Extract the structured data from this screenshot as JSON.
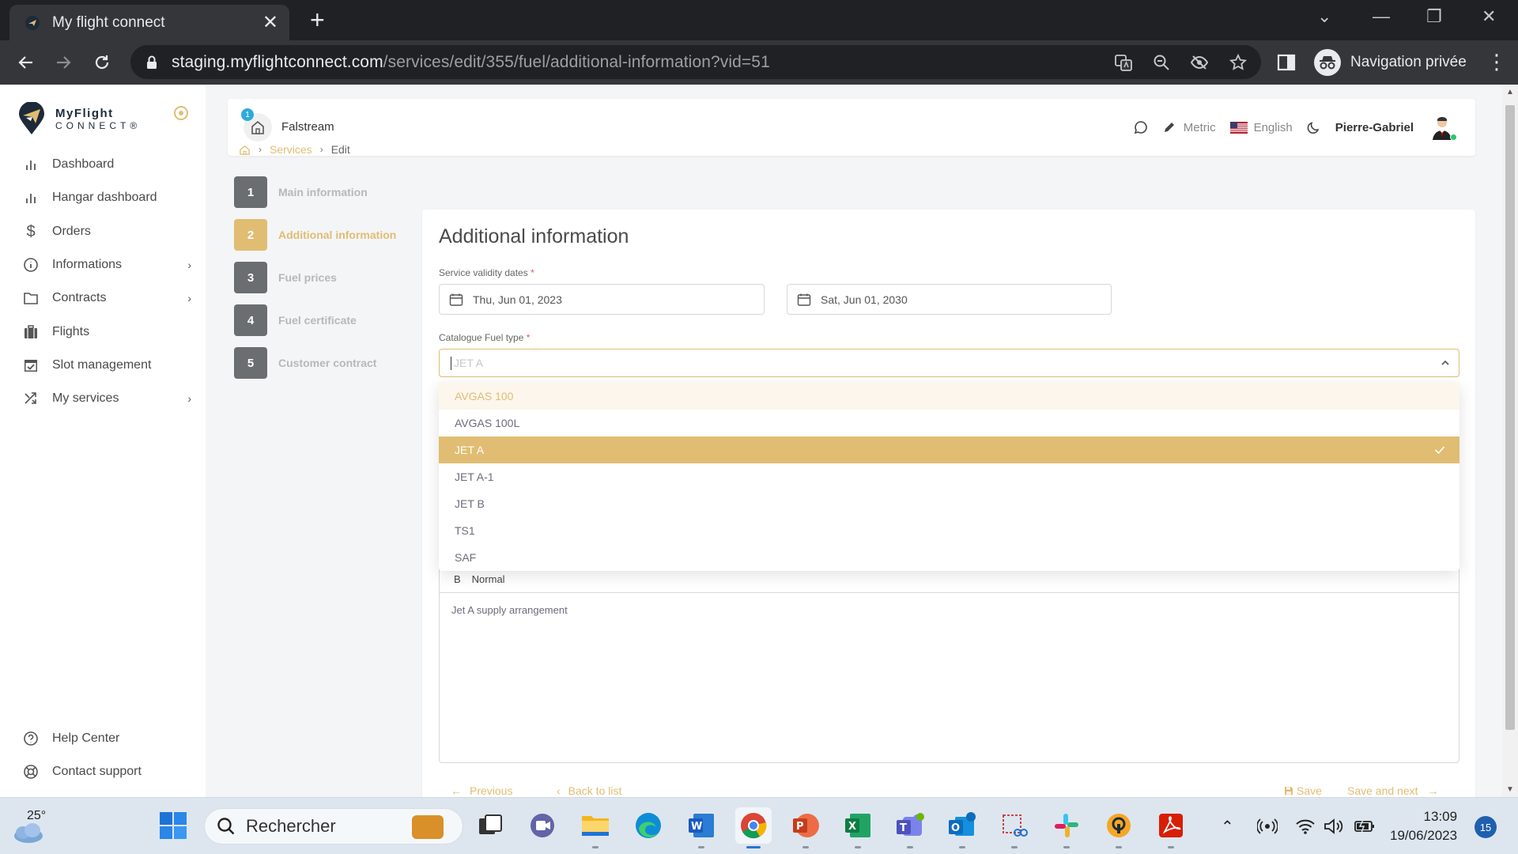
{
  "browser": {
    "tab_title": "My flight connect",
    "url_host": "staging.myflightconnect.com",
    "url_path": "/services/edit/355/fuel/additional-information?vid=51",
    "profile_label": "Navigation privée"
  },
  "sidebar": {
    "logo_line1": "MyFlight",
    "logo_line2": "CONNECT®",
    "items": [
      {
        "label": "Dashboard",
        "icon": "bar-chart-icon",
        "has_children": false
      },
      {
        "label": "Hangar dashboard",
        "icon": "bar-chart-icon",
        "has_children": false
      },
      {
        "label": "Orders",
        "icon": "dollar-icon",
        "has_children": false
      },
      {
        "label": "Informations",
        "icon": "info-icon",
        "has_children": true
      },
      {
        "label": "Contracts",
        "icon": "folder-icon",
        "has_children": true
      },
      {
        "label": "Flights",
        "icon": "luggage-icon",
        "has_children": false
      },
      {
        "label": "Slot management",
        "icon": "calendar-check-icon",
        "has_children": false
      },
      {
        "label": "My services",
        "icon": "shuffle-icon",
        "has_children": true
      }
    ],
    "footer_items": [
      {
        "label": "Help Center",
        "icon": "help-icon"
      },
      {
        "label": "Contact support",
        "icon": "lifebuoy-icon"
      }
    ]
  },
  "header": {
    "notification_count": "1",
    "company": "Falstream",
    "units": "Metric",
    "language": "English",
    "user": "Pierre-Gabriel"
  },
  "breadcrumb": {
    "link": "Services",
    "current": "Edit"
  },
  "steps": [
    {
      "num": "1",
      "label": "Main information",
      "active": false
    },
    {
      "num": "2",
      "label": "Additional information",
      "active": true
    },
    {
      "num": "3",
      "label": "Fuel prices",
      "active": false
    },
    {
      "num": "4",
      "label": "Fuel certificate",
      "active": false
    },
    {
      "num": "5",
      "label": "Customer contract",
      "active": false
    }
  ],
  "form": {
    "title": "Additional information",
    "validity_label": "Service validity dates",
    "required_mark": "*",
    "date_start": "Thu, Jun 01, 2023",
    "date_end": "Sat, Jun 01, 2030",
    "fuel_type_label": "Catalogue Fuel type",
    "fuel_type_placeholder": "JET A",
    "fuel_options": [
      "AVGAS 100",
      "AVGAS 100L",
      "JET A",
      "JET A-1",
      "JET B",
      "TS1",
      "SAF"
    ],
    "hovered_option": "AVGAS 100",
    "selected_option": "JET A",
    "editor_format": "Normal",
    "editor_text": "Jet A supply arrangement"
  },
  "footer_actions": {
    "previous": "Previous",
    "back": "Back to list",
    "save": "Save",
    "save_next": "Save and next"
  },
  "taskbar": {
    "temperature": "25°",
    "search_label": "Rechercher",
    "time": "13:09",
    "date": "19/06/2023",
    "notifications": "15"
  },
  "colors": {
    "accent": "#e0bd72",
    "step_inactive": "#6b6e70",
    "chrome_dark": "#202124"
  }
}
